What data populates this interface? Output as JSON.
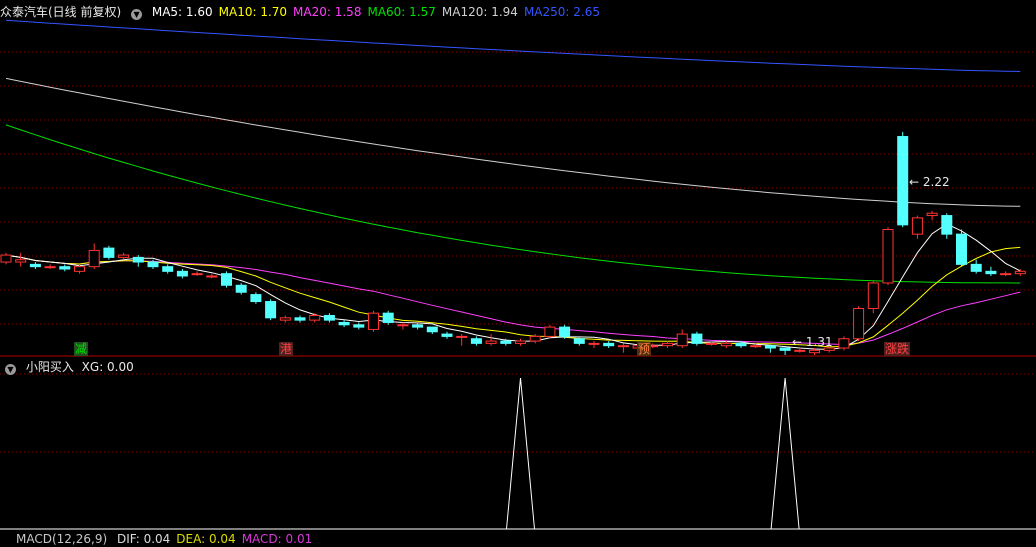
{
  "title": "众泰汽车(日线 前复权)",
  "indicator_header": {
    "icon": "chevron-down-icon",
    "items": [
      {
        "label": "MA5: 1.60",
        "color": "#ffffff"
      },
      {
        "label": "MA10: 1.70",
        "color": "#ffff00"
      },
      {
        "label": "MA20: 1.58",
        "color": "#ff40ff"
      },
      {
        "label": "MA60: 1.57",
        "color": "#00e000"
      },
      {
        "label": "MA120: 1.94",
        "color": "#d0d0d0"
      },
      {
        "label": "MA250: 2.65",
        "color": "#3355ff"
      }
    ]
  },
  "sub_panel": {
    "icon": "chevron-down-icon",
    "title": "小阳买入",
    "value_label": "XG: 0.00"
  },
  "bottom_header": {
    "title": "MACD(12,26,9)",
    "items": [
      {
        "label": "DIF: 0.04",
        "color": "#ffffff"
      },
      {
        "label": "DEA: 0.04",
        "color": "#ffff00"
      },
      {
        "label": "MACD: 0.01",
        "color": "#ff40ff"
      }
    ]
  },
  "event_markers": [
    {
      "label": "减",
      "color": "#00e000",
      "bg": "#205020"
    },
    {
      "label": "港",
      "color": "#ff4040",
      "bg": "#502020"
    },
    {
      "label": "预",
      "color": "#ff8040",
      "bg": "#503010"
    },
    {
      "label": "涨跌",
      "color": "#ff4040",
      "bg": "#502020"
    }
  ],
  "annotations": {
    "high": "2.22",
    "low": "1.31"
  },
  "colors": {
    "up": "#ff3333",
    "down": "#54ffff",
    "grid": "#8b0000",
    "axis": "#b00000"
  },
  "chart_data": {
    "type": "candlestick",
    "ylim": [
      1.26,
      2.71
    ],
    "candles": [
      [
        1.66,
        1.69,
        1.7,
        1.65
      ],
      [
        1.66,
        1.67,
        1.7,
        1.64
      ],
      [
        1.65,
        1.64,
        1.66,
        1.63
      ],
      [
        1.64,
        1.64,
        1.65,
        1.63
      ],
      [
        1.64,
        1.63,
        1.65,
        1.62
      ],
      [
        1.62,
        1.64,
        1.65,
        1.61
      ],
      [
        1.64,
        1.71,
        1.74,
        1.63
      ],
      [
        1.72,
        1.68,
        1.73,
        1.67
      ],
      [
        1.68,
        1.69,
        1.7,
        1.67
      ],
      [
        1.68,
        1.66,
        1.69,
        1.64
      ],
      [
        1.66,
        1.64,
        1.67,
        1.63
      ],
      [
        1.64,
        1.62,
        1.65,
        1.61
      ],
      [
        1.62,
        1.6,
        1.63,
        1.59
      ],
      [
        1.61,
        1.61,
        1.62,
        1.6
      ],
      [
        1.6,
        1.6,
        1.61,
        1.59
      ],
      [
        1.61,
        1.56,
        1.62,
        1.55
      ],
      [
        1.56,
        1.53,
        1.57,
        1.52
      ],
      [
        1.52,
        1.49,
        1.53,
        1.48
      ],
      [
        1.49,
        1.42,
        1.5,
        1.41
      ],
      [
        1.41,
        1.42,
        1.43,
        1.4
      ],
      [
        1.42,
        1.41,
        1.43,
        1.4
      ],
      [
        1.41,
        1.43,
        1.44,
        1.4
      ],
      [
        1.43,
        1.41,
        1.44,
        1.4
      ],
      [
        1.4,
        1.39,
        1.41,
        1.38
      ],
      [
        1.39,
        1.38,
        1.4,
        1.37
      ],
      [
        1.37,
        1.44,
        1.45,
        1.36
      ],
      [
        1.44,
        1.4,
        1.45,
        1.39
      ],
      [
        1.39,
        1.39,
        1.4,
        1.37
      ],
      [
        1.39,
        1.38,
        1.4,
        1.37
      ],
      [
        1.38,
        1.36,
        1.38,
        1.35
      ],
      [
        1.35,
        1.34,
        1.36,
        1.33
      ],
      [
        1.34,
        1.34,
        1.35,
        1.3
      ],
      [
        1.33,
        1.31,
        1.34,
        1.3
      ],
      [
        1.31,
        1.32,
        1.35,
        1.3
      ],
      [
        1.32,
        1.31,
        1.33,
        1.3
      ],
      [
        1.31,
        1.32,
        1.33,
        1.3
      ],
      [
        1.32,
        1.34,
        1.35,
        1.31
      ],
      [
        1.34,
        1.38,
        1.39,
        1.33
      ],
      [
        1.38,
        1.34,
        1.39,
        1.33
      ],
      [
        1.33,
        1.31,
        1.34,
        1.3
      ],
      [
        1.31,
        1.31,
        1.32,
        1.29
      ],
      [
        1.31,
        1.3,
        1.32,
        1.29
      ],
      [
        1.3,
        1.3,
        1.31,
        1.27
      ],
      [
        1.29,
        1.3,
        1.31,
        1.28
      ],
      [
        1.3,
        1.3,
        1.31,
        1.29
      ],
      [
        1.3,
        1.31,
        1.32,
        1.29
      ],
      [
        1.3,
        1.35,
        1.37,
        1.29
      ],
      [
        1.35,
        1.31,
        1.36,
        1.3
      ],
      [
        1.31,
        1.31,
        1.32,
        1.3
      ],
      [
        1.3,
        1.31,
        1.32,
        1.29
      ],
      [
        1.31,
        1.3,
        1.32,
        1.29
      ],
      [
        1.3,
        1.3,
        1.31,
        1.29
      ],
      [
        1.3,
        1.29,
        1.3,
        1.27
      ],
      [
        1.29,
        1.28,
        1.29,
        1.26
      ],
      [
        1.28,
        1.28,
        1.29,
        1.27
      ],
      [
        1.27,
        1.28,
        1.29,
        1.26
      ],
      [
        1.28,
        1.29,
        1.31,
        1.27
      ],
      [
        1.29,
        1.33,
        1.34,
        1.28
      ],
      [
        1.33,
        1.46,
        1.47,
        1.32
      ],
      [
        1.46,
        1.57,
        1.58,
        1.44
      ],
      [
        1.57,
        1.8,
        1.81,
        1.56
      ],
      [
        2.2,
        1.82,
        2.22,
        1.81
      ],
      [
        1.78,
        1.85,
        1.86,
        1.76
      ],
      [
        1.86,
        1.87,
        1.88,
        1.84
      ],
      [
        1.86,
        1.78,
        1.87,
        1.76
      ],
      [
        1.78,
        1.65,
        1.8,
        1.64
      ],
      [
        1.65,
        1.62,
        1.67,
        1.61
      ],
      [
        1.62,
        1.61,
        1.64,
        1.6
      ],
      [
        1.61,
        1.61,
        1.62,
        1.6
      ],
      [
        1.61,
        1.62,
        1.63,
        1.6
      ]
    ],
    "sub_ylim": [
      0,
      1
    ],
    "signal_x": [
      35,
      53
    ]
  }
}
